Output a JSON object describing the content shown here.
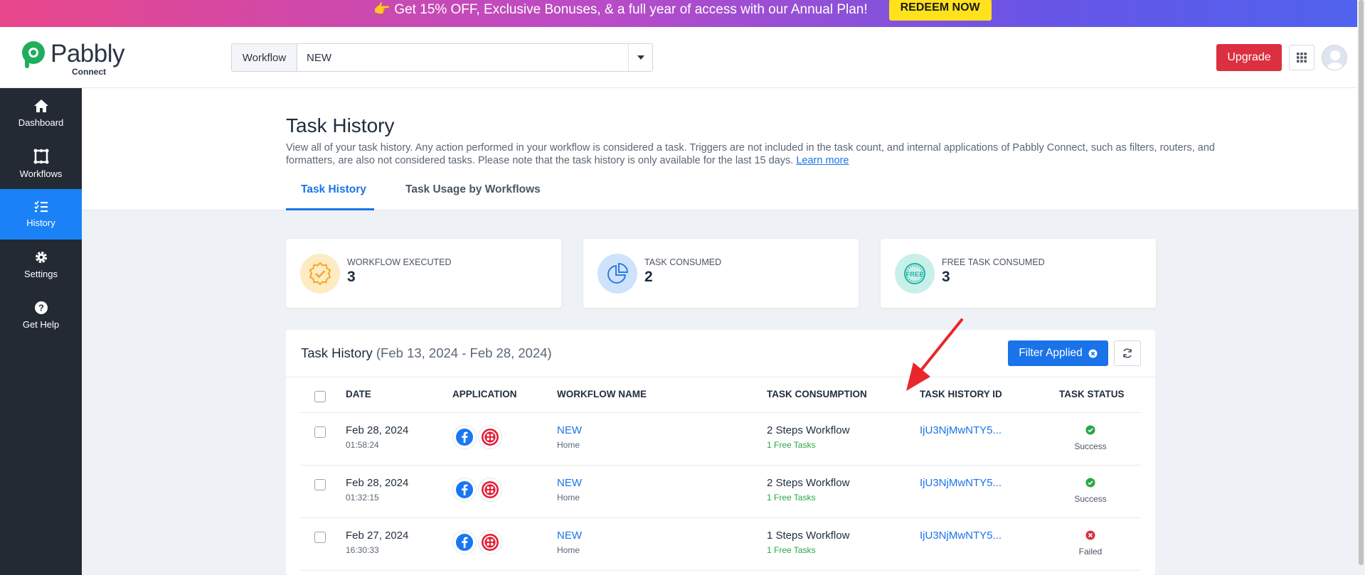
{
  "promo": {
    "text": "👉 Get 15% OFF, Exclusive Bonuses, & a full year of access with our Annual Plan!",
    "button": "REDEEM NOW"
  },
  "header": {
    "logo_word": "Pabbly",
    "logo_sub": "Connect",
    "workflow_label": "Workflow",
    "workflow_value": "NEW",
    "upgrade": "Upgrade"
  },
  "sidebar": {
    "items": [
      {
        "label": "Dashboard",
        "icon": "home-icon"
      },
      {
        "label": "Workflows",
        "icon": "workflows-icon"
      },
      {
        "label": "History",
        "icon": "history-icon",
        "active": true
      },
      {
        "label": "Settings",
        "icon": "gear-icon"
      },
      {
        "label": "Get Help",
        "icon": "help-icon"
      }
    ]
  },
  "page": {
    "title": "Task History",
    "description": "View all of your task history. Any action performed in your workflow is considered a task. Triggers are not included in the task count, and internal applications of Pabbly Connect, such as filters, routers, and formatters, are also not considered tasks. Please note that the task history is only available for the last 15 days.",
    "learn_more": "Learn more",
    "tabs": [
      {
        "label": "Task History",
        "active": true
      },
      {
        "label": "Task Usage by Workflows",
        "active": false
      }
    ]
  },
  "stats": [
    {
      "label": "WORKFLOW EXECUTED",
      "value": "3",
      "icon": "badge-check-icon",
      "color": "#f5a623"
    },
    {
      "label": "TASK CONSUMED",
      "value": "2",
      "icon": "pie-chart-icon",
      "color": "#2d7be5"
    },
    {
      "label": "FREE TASK CONSUMED",
      "value": "3",
      "icon": "free-badge-icon",
      "color": "#1fb5a8"
    }
  ],
  "history": {
    "title": "Task History",
    "range": "(Feb 13, 2024 - Feb 28, 2024)",
    "filter_button": "Filter Applied",
    "columns": [
      "DATE",
      "APPLICATION",
      "WORKFLOW NAME",
      "TASK CONSUMPTION",
      "TASK HISTORY ID",
      "TASK STATUS"
    ],
    "rows": [
      {
        "date": "Feb 28, 2024",
        "time": "01:58:24",
        "workflow": "NEW",
        "folder": "Home",
        "consumption": "2 Steps Workflow",
        "free": "1 Free Tasks",
        "id": "IjU3NjMwNTY5...",
        "status": "Success"
      },
      {
        "date": "Feb 28, 2024",
        "time": "01:32:15",
        "workflow": "NEW",
        "folder": "Home",
        "consumption": "2 Steps Workflow",
        "free": "1 Free Tasks",
        "id": "IjU3NjMwNTY5...",
        "status": "Success"
      },
      {
        "date": "Feb 27, 2024",
        "time": "16:30:33",
        "workflow": "NEW",
        "folder": "Home",
        "consumption": "1 Steps Workflow",
        "free": "1 Free Tasks",
        "id": "IjU3NjMwNTY5...",
        "status": "Failed"
      }
    ]
  },
  "colors": {
    "accent": "#1a73e8",
    "sidebar": "#232a34",
    "sidebar_active": "#1a82f6",
    "upgrade": "#dc2f3f",
    "success": "#28a745",
    "failed": "#dc2f3f",
    "annotation_arrow": "#e8262b"
  }
}
